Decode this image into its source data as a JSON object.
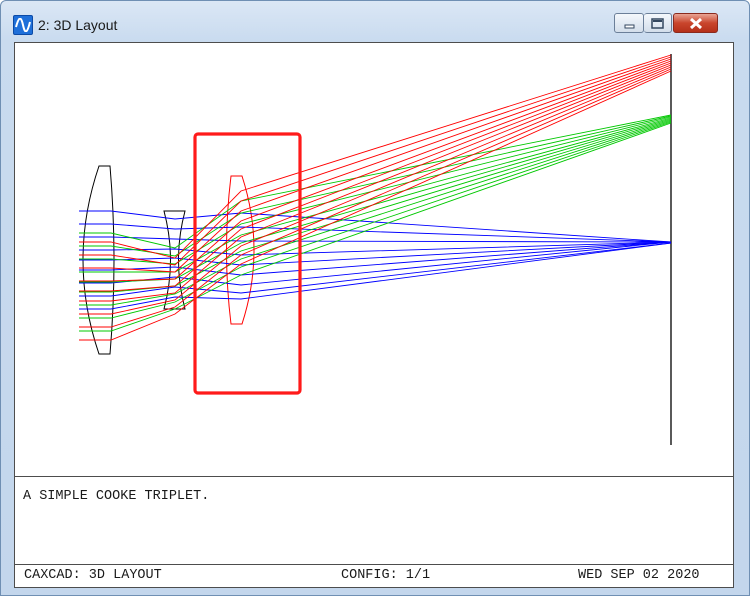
{
  "window": {
    "title": "2: 3D Layout",
    "controls": {
      "minimize": "minimize",
      "maximize": "maximize",
      "close": "close"
    }
  },
  "layout": {
    "description_text": "A SIMPLE COOKE TRIPLET.",
    "footer": {
      "left": "CAXCAD: 3D LAYOUT",
      "center": "CONFIG: 1/1",
      "right": "WED SEP 02 2020"
    },
    "ray_colors": {
      "field_0": "#0000ff",
      "field_1": "#00c800",
      "field_2": "#ff0000"
    },
    "highlighted_element": "lens-3",
    "highlight_color": "#ff0000"
  }
}
